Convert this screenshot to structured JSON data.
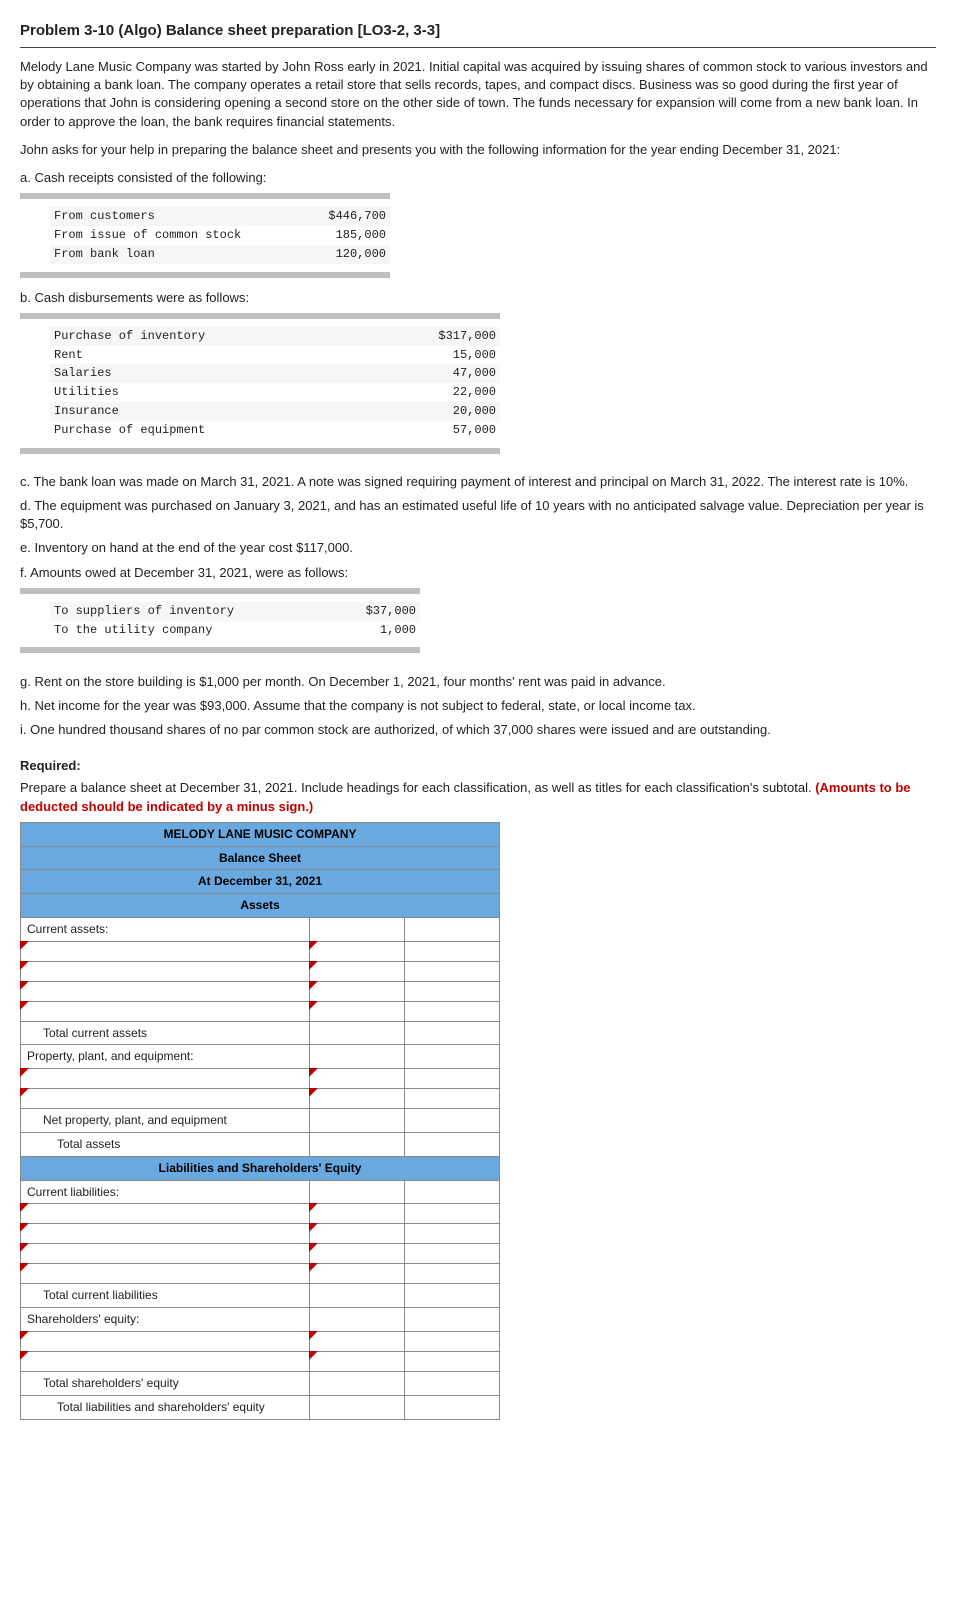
{
  "title": "Problem 3-10 (Algo) Balance sheet preparation [LO3-2, 3-3]",
  "para1": "Melody Lane Music Company was started by John Ross early in 2021. Initial capital was acquired by issuing shares of common stock to various investors and by obtaining a bank loan. The company operates a retail store that sells records, tapes, and compact discs. Business was so good during the first year of operations that John is considering opening a second store on the other side of town. The funds necessary for expansion will come from a new bank loan. In order to approve the loan, the bank requires financial statements.",
  "para2": "John asks for your help in preparing the balance sheet and presents you with the following information for the year ending December 31, 2021:",
  "a_intro": "a. Cash receipts consisted of the following:",
  "receipts": {
    "rows": [
      {
        "label": "From customers",
        "value": "$446,700"
      },
      {
        "label": "From issue of common stock",
        "value": "185,000"
      },
      {
        "label": "From bank loan",
        "value": "120,000"
      }
    ]
  },
  "b_intro": "b. Cash disbursements were as follows:",
  "disburse": {
    "rows": [
      {
        "label": "Purchase of inventory",
        "value": "$317,000"
      },
      {
        "label": "Rent",
        "value": "15,000"
      },
      {
        "label": "Salaries",
        "value": "47,000"
      },
      {
        "label": "Utilities",
        "value": "22,000"
      },
      {
        "label": "Insurance",
        "value": "20,000"
      },
      {
        "label": "Purchase of equipment",
        "value": "57,000"
      }
    ]
  },
  "c_text": "c. The bank loan was made on March 31, 2021. A note was signed requiring payment of interest and principal on March 31, 2022. The interest rate is 10%.",
  "d_text": "d. The equipment was purchased on January 3, 2021, and has an estimated useful life of 10 years with no anticipated salvage value. Depreciation per year is $5,700.",
  "e_text": "e. Inventory on hand at the end of the year cost $117,000.",
  "f_text": "f. Amounts owed at December 31, 2021, were as follows:",
  "owed": {
    "rows": [
      {
        "label": "To suppliers of inventory",
        "value": "$37,000"
      },
      {
        "label": "To the utility company",
        "value": "1,000"
      }
    ]
  },
  "g_text": "g. Rent on the store building is $1,000 per month. On December 1, 2021, four months' rent was paid in advance.",
  "h_text": "h. Net income for the year was $93,000. Assume that the company is not subject to federal, state, or local income tax.",
  "i_text": "i. One hundred thousand shares of no par common stock are authorized, of which 37,000 shares were issued and are outstanding.",
  "required_label": "Required:",
  "required_text": "Prepare a balance sheet at December 31, 2021. Include headings for each classification, as well as titles for each classification's subtotal. ",
  "required_red": "(Amounts to be deducted should be indicated by a minus sign.)",
  "bs": {
    "h1": "MELODY LANE MUSIC COMPANY",
    "h2": "Balance Sheet",
    "h3": "At December 31, 2021",
    "h4": "Assets",
    "current_assets": "Current assets:",
    "total_current_assets": "Total current assets",
    "ppe": "Property, plant, and equipment:",
    "net_ppe": "Net property, plant, and equipment",
    "total_assets": "Total assets",
    "h5": "Liabilities and Shareholders' Equity",
    "current_liab": "Current liabilities:",
    "total_current_liab": "Total current liabilities",
    "se": "Shareholders' equity:",
    "total_se": "Total shareholders' equity",
    "total_lse": "Total liabilities and shareholders' equity"
  }
}
